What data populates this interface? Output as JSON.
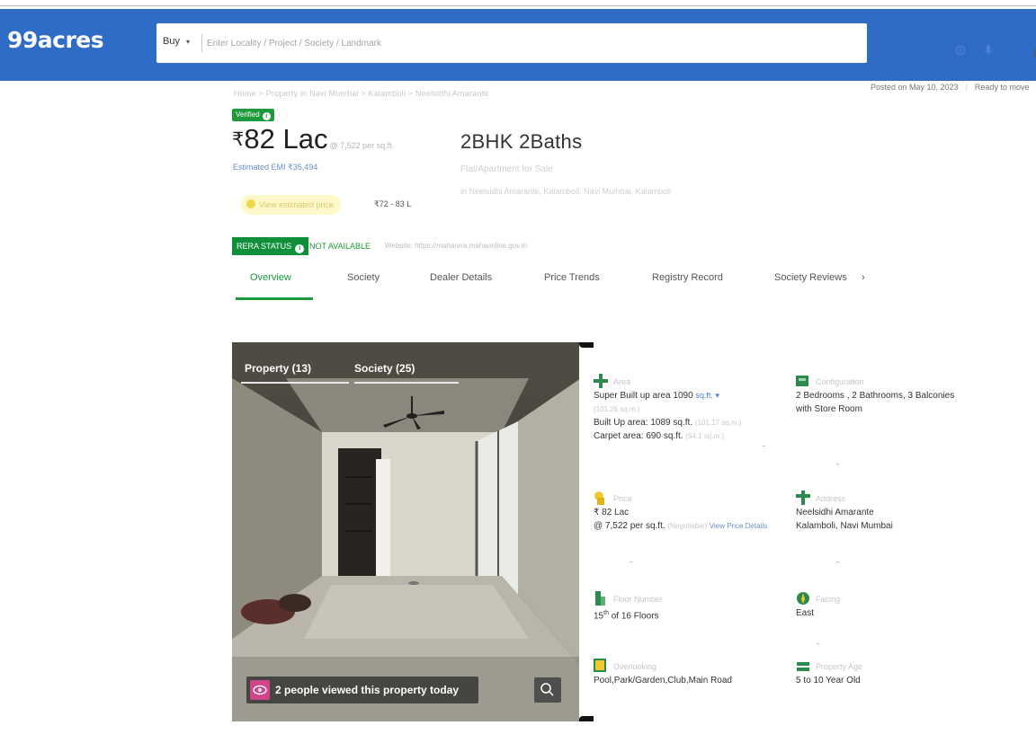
{
  "header": {
    "logo": "99acres",
    "buy_label": "Buy",
    "buy_caret": "▾",
    "search_placeholder": "Enter Locality / Project / Society / Landmark"
  },
  "posted_on": "Posted on May 10, 2023",
  "availability": "Ready to move",
  "breadcrumb": "Home > Property in Navi Mumbai > Kalamboli > Neelsidhi Amarante",
  "summary": {
    "verified_label": "Verified",
    "price_symbol": "₹",
    "price": "82 Lac",
    "price_per_sqft": "@ 7,522 per sq.ft.",
    "emi": "Estimated EMI ₹35,494",
    "config": "2BHK 2Baths",
    "subtitle": "Flat/Apartment for Sale",
    "address": "in Neelsidhi Amarante, Kalamboli, Navi Mumbai, Kalamboli",
    "estimate_label": "View estimated price",
    "estimate_range": "₹72 - 83 L",
    "rera_label": "RERA STATUS",
    "rera_status": "NOT AVAILABLE",
    "rera_website": "Website: https://maharera.mahaonline.gov.in"
  },
  "tabs": [
    "Overview",
    "Society",
    "Dealer Details",
    "Price Trends",
    "Registry Record",
    "Society Reviews"
  ],
  "tabs_more": "›",
  "photo": {
    "tab_property": "Property (13)",
    "tab_society": "Society (25)",
    "viewers_text": "2 people viewed this property today"
  },
  "details": {
    "area": {
      "label": "Area",
      "super_built_up": "Super Built up area 1090",
      "unit": "sq.ft.",
      "unit_caret": "▾",
      "super_built_up_sqm": "(101.26 sq.m.)",
      "built_up": "Built Up area: 1089 sq.ft.",
      "built_up_sqm": "(101.17 sq.m.)",
      "carpet": "Carpet area: 690 sq.ft.",
      "carpet_sqm": "(64.1 sq.m.)"
    },
    "configuration": {
      "label": "Configuration",
      "line1": "2 Bedrooms , 2 Bathrooms, 3 Balconies",
      "line2": "with Store Room"
    },
    "price": {
      "label": "Price",
      "value": "₹ 82 Lac",
      "per_sqft": "@ 7,522 per sq.ft.",
      "negotiable": "(Negotiable)",
      "view_details": "View Price Details"
    },
    "address": {
      "label": "Address",
      "line1": "Neelsidhi Amarante",
      "line2": "Kalamboli, Navi Mumbai"
    },
    "floor": {
      "label": "Floor Number",
      "value": "15",
      "suffix": "th",
      "total": "of 16 Floors"
    },
    "facing": {
      "label": "Facing",
      "value": "East"
    },
    "overlooking": {
      "label": "Overlooking",
      "value": "Pool,Park/Garden,Club,Main Road"
    },
    "age": {
      "label": "Property Age",
      "value": "5 to 10 Year Old"
    }
  },
  "colors": {
    "brand_blue": "#2f6cc5",
    "green": "#1d9a3c",
    "link_blue": "#4a7fd3"
  }
}
